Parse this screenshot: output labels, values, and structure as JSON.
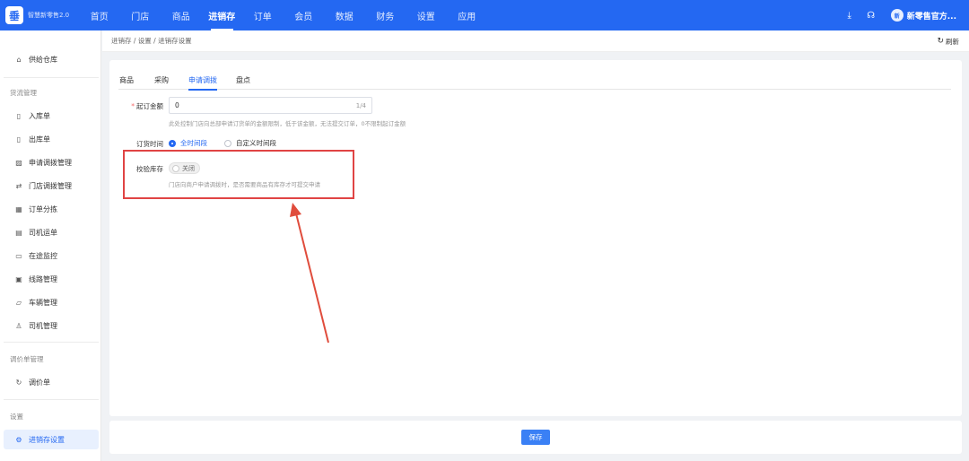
{
  "app": {
    "logo_glyph": "垂",
    "name": "智慧新零售2.0"
  },
  "nav": {
    "items": [
      "首页",
      "门店",
      "商品",
      "进销存",
      "订单",
      "会员",
      "数据",
      "财务",
      "设置",
      "应用"
    ],
    "active": "进销存"
  },
  "topbar": {
    "download_icon": "⤓",
    "headset_icon": "☊",
    "avatar_text": "新",
    "user_name": "新零售官方...",
    "caret": "⌄"
  },
  "sidebar": {
    "top_item": "供给仓库",
    "group1": "货流管理",
    "group1_items": [
      "入库单",
      "出库单",
      "申请调拨管理",
      "门店调拨管理",
      "订单分拣",
      "司机运单",
      "在途监控",
      "线路管理",
      "车辆管理",
      "司机管理"
    ],
    "group2": "调价单管理",
    "group2_items": [
      "调价单"
    ],
    "group3": "设置",
    "group3_items": [
      "进销存设置"
    ],
    "active": "进销存设置"
  },
  "breadcrumb": "进销存 / 设置 / 进销存设置",
  "refresh_label": "刷新",
  "tabs": [
    "商品",
    "采购",
    "申请调拨",
    "盘点"
  ],
  "active_tab": "申请调拨",
  "form": {
    "min_amount": {
      "label": "起订金额",
      "value": "0",
      "count": "1/4",
      "hint": "此处控制门店向总部申请订货单的金额限制，低于该金额，无法提交订单，0不限制起订金额"
    },
    "order_time": {
      "label": "订货时间",
      "options": [
        "全时间段",
        "自定义时间段"
      ],
      "selected": "全时间段"
    },
    "check_stock": {
      "label": "校验库存",
      "switch_label": "关闭",
      "hint": "门店向商户申请调拨时，是否需要商品有库存才可提交申请"
    }
  },
  "save_label": "保存",
  "colors": {
    "primary": "#2468f2",
    "highlight": "#e04444",
    "arrow": "#e04c3c"
  }
}
